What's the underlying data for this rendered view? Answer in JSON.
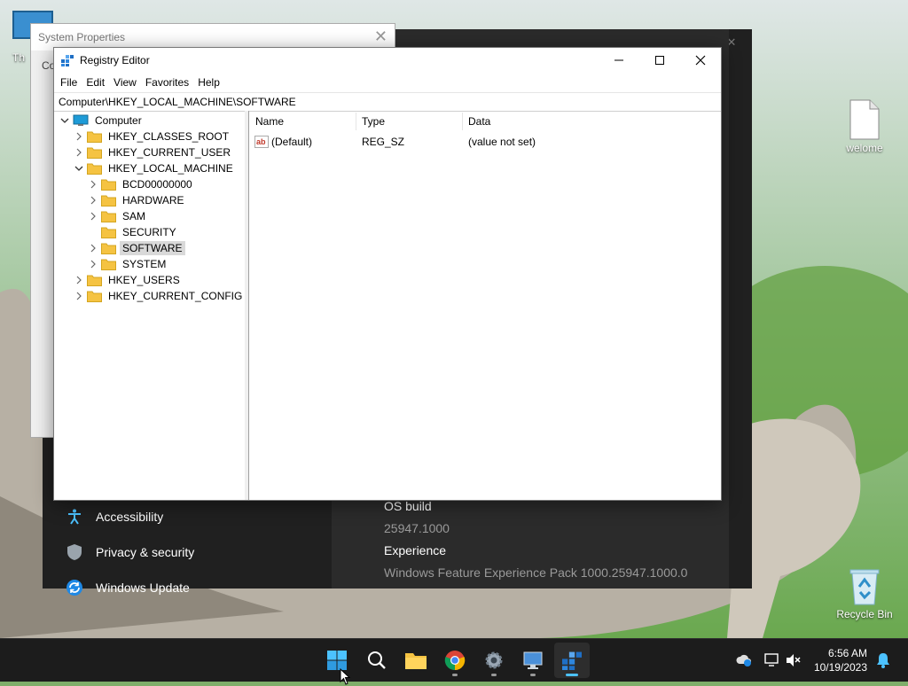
{
  "desktop": {
    "icons": [
      {
        "label": "welome"
      },
      {
        "label": "Recycle Bin"
      }
    ],
    "partial_icon_label": "Th"
  },
  "settings_window": {
    "nav": [
      {
        "label": "Accessibility",
        "icon": "accessibility-icon"
      },
      {
        "label": "Privacy & security",
        "icon": "shield-icon"
      },
      {
        "label": "Windows Update",
        "icon": "update-icon"
      }
    ],
    "specs": {
      "os_build_label": "OS build",
      "os_build_value": "25947.1000",
      "experience_label": "Experience",
      "experience_value": "Windows Feature Experience Pack 1000.25947.1000.0"
    }
  },
  "system_properties": {
    "title": "System Properties",
    "tab_stub": "Co"
  },
  "registry_editor": {
    "title": "Registry Editor",
    "menu": [
      "File",
      "Edit",
      "View",
      "Favorites",
      "Help"
    ],
    "address": "Computer\\HKEY_LOCAL_MACHINE\\SOFTWARE",
    "tree": [
      {
        "label": "Computer",
        "depth": 0,
        "expander": "down",
        "kind": "computer"
      },
      {
        "label": "HKEY_CLASSES_ROOT",
        "depth": 1,
        "expander": "right",
        "kind": "folder"
      },
      {
        "label": "HKEY_CURRENT_USER",
        "depth": 1,
        "expander": "right",
        "kind": "folder"
      },
      {
        "label": "HKEY_LOCAL_MACHINE",
        "depth": 1,
        "expander": "down",
        "kind": "folder"
      },
      {
        "label": "BCD00000000",
        "depth": 2,
        "expander": "right",
        "kind": "folder"
      },
      {
        "label": "HARDWARE",
        "depth": 2,
        "expander": "right",
        "kind": "folder"
      },
      {
        "label": "SAM",
        "depth": 2,
        "expander": "right",
        "kind": "folder"
      },
      {
        "label": "SECURITY",
        "depth": 2,
        "expander": "none",
        "kind": "folder"
      },
      {
        "label": "SOFTWARE",
        "depth": 2,
        "expander": "right",
        "kind": "folder",
        "selected": true
      },
      {
        "label": "SYSTEM",
        "depth": 2,
        "expander": "right",
        "kind": "folder"
      },
      {
        "label": "HKEY_USERS",
        "depth": 1,
        "expander": "right",
        "kind": "folder"
      },
      {
        "label": "HKEY_CURRENT_CONFIG",
        "depth": 1,
        "expander": "right",
        "kind": "folder"
      }
    ],
    "columns": {
      "name": "Name",
      "type": "Type",
      "data": "Data"
    },
    "values": [
      {
        "name": "(Default)",
        "type": "REG_SZ",
        "data": "(value not set)",
        "icon": "string-value-icon"
      }
    ]
  },
  "taskbar": {
    "apps": [
      {
        "name": "start-button",
        "icon": "windows-logo-icon"
      },
      {
        "name": "search-button",
        "icon": "search-icon"
      },
      {
        "name": "file-explorer-button",
        "icon": "folder-icon"
      },
      {
        "name": "chrome-button",
        "icon": "chrome-icon"
      },
      {
        "name": "settings-button",
        "icon": "gear-icon"
      },
      {
        "name": "system-properties-button",
        "icon": "computer-icon"
      },
      {
        "name": "registry-editor-button",
        "icon": "registry-icon",
        "active": true
      }
    ],
    "time": "6:56 AM",
    "date": "10/19/2023"
  },
  "colors": {
    "accent": "#4cc2ff",
    "folder": "#f5c342",
    "taskbar": "#1c1c1c"
  }
}
